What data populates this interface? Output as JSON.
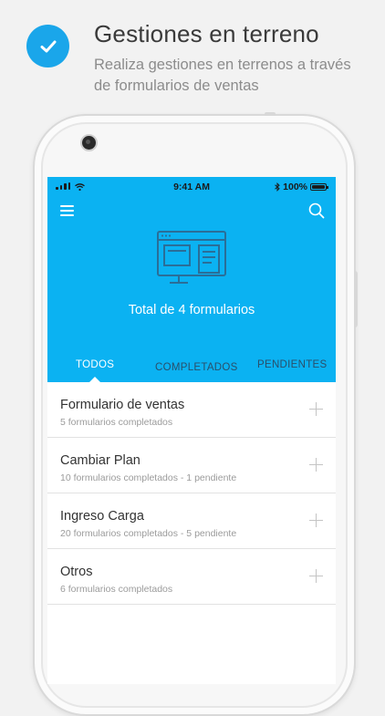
{
  "promo": {
    "title": "Gestiones en terreno",
    "subtitle": "Realiza gestiones en terrenos a través de formularios de ventas"
  },
  "status_bar": {
    "time": "9:41 AM",
    "battery": "100%"
  },
  "header": {
    "total_label": "Total de 4 formularios"
  },
  "tabs": [
    {
      "label": "TODOS",
      "active": true
    },
    {
      "label": "COMPLETADOS",
      "active": false
    },
    {
      "label": "PENDIENTES",
      "active": false
    }
  ],
  "forms": [
    {
      "title": "Formulario de ventas",
      "subtitle": "5 formularios completados"
    },
    {
      "title": "Cambiar Plan",
      "subtitle": "10 formularios completados - 1 pendiente"
    },
    {
      "title": "Ingreso Carga",
      "subtitle": "20 formularios completados - 5 pendiente"
    },
    {
      "title": "Otros",
      "subtitle": "6 formularios completados"
    }
  ],
  "colors": {
    "accent": "#0bb2f2",
    "badge": "#1aa6ea",
    "tab_inactive": "#2a4f6a"
  },
  "icons": [
    "check-icon",
    "menu-icon",
    "search-icon",
    "forms-illustration-icon",
    "plus-icon",
    "wifi-icon",
    "bluetooth-icon",
    "battery-icon"
  ]
}
